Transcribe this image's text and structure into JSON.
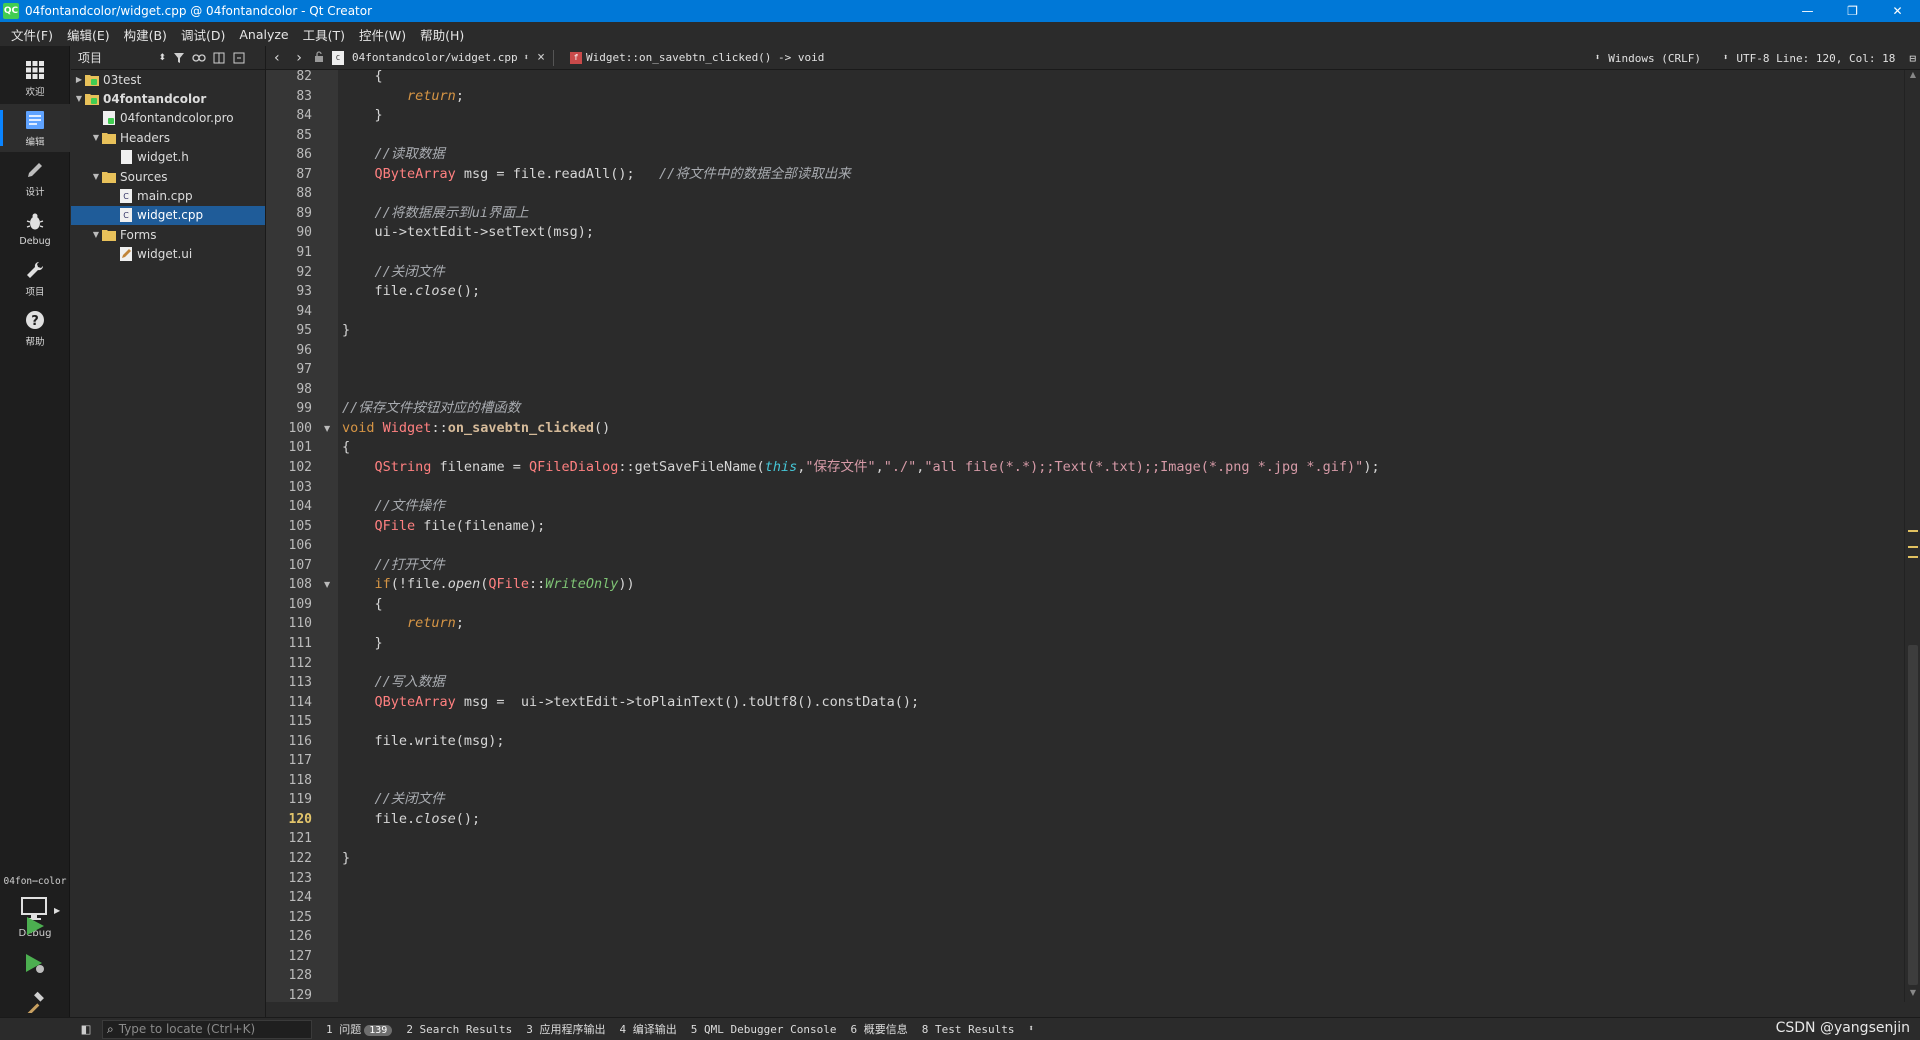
{
  "window": {
    "app_icon": "QC",
    "title": "04fontandcolor/widget.cpp @ 04fontandcolor - Qt Creator",
    "minimize": "—",
    "maximize": "❐",
    "close": "✕"
  },
  "menu": [
    "文件(F)",
    "编辑(E)",
    "构建(B)",
    "调试(D)",
    "Analyze",
    "工具(T)",
    "控件(W)",
    "帮助(H)"
  ],
  "modes": [
    {
      "label": "欢迎",
      "icon": "grid-icon"
    },
    {
      "label": "编辑",
      "icon": "edit-document-icon"
    },
    {
      "label": "设计",
      "icon": "pencil-icon"
    },
    {
      "label": "Debug",
      "icon": "bug-icon"
    },
    {
      "label": "项目",
      "icon": "wrench-icon"
    },
    {
      "label": "帮助",
      "icon": "help-icon"
    }
  ],
  "kit": {
    "project": "04fon⋯color",
    "mode": "Debug"
  },
  "project_pane": {
    "view": "项目",
    "tree": [
      {
        "label": "03test",
        "level": 0,
        "arrow": "▶",
        "icon": "project-folder",
        "bold": false,
        "selected": false
      },
      {
        "label": "04fontandcolor",
        "level": 0,
        "arrow": "▼",
        "icon": "project-folder",
        "bold": true,
        "selected": false
      },
      {
        "label": "04fontandcolor.pro",
        "level": 1,
        "arrow": "",
        "icon": "pro-file",
        "bold": false,
        "selected": false
      },
      {
        "label": "Headers",
        "level": 1,
        "arrow": "▼",
        "icon": "folder",
        "bold": false,
        "selected": false
      },
      {
        "label": "widget.h",
        "level": 2,
        "arrow": "",
        "icon": "header-file",
        "bold": false,
        "selected": false
      },
      {
        "label": "Sources",
        "level": 1,
        "arrow": "▼",
        "icon": "folder",
        "bold": false,
        "selected": false
      },
      {
        "label": "main.cpp",
        "level": 2,
        "arrow": "",
        "icon": "cpp-file",
        "bold": false,
        "selected": false
      },
      {
        "label": "widget.cpp",
        "level": 2,
        "arrow": "",
        "icon": "cpp-file",
        "bold": false,
        "selected": true
      },
      {
        "label": "Forms",
        "level": 1,
        "arrow": "▼",
        "icon": "folder",
        "bold": false,
        "selected": false
      },
      {
        "label": "widget.ui",
        "level": 2,
        "arrow": "",
        "icon": "ui-file",
        "bold": false,
        "selected": false
      }
    ]
  },
  "editor": {
    "document": "04fontandcolor/widget.cpp",
    "symbol": "Widget::on_savebtn_clicked() -> void",
    "line_ending": "Windows (CRLF)",
    "encoding_position": "UTF-8 Line: 120, Col: 18",
    "current_line": 120,
    "lines": [
      {
        "n": 82,
        "code": [
          [
            "    {",
            ""
          ]
        ]
      },
      {
        "n": 83,
        "code": [
          [
            "        ",
            ""
          ],
          [
            "return",
            "k it"
          ],
          [
            ";",
            ""
          ]
        ]
      },
      {
        "n": 84,
        "code": [
          [
            "    }",
            ""
          ]
        ]
      },
      {
        "n": 85,
        "code": []
      },
      {
        "n": 86,
        "code": [
          [
            "    ",
            ""
          ],
          [
            "//读取数据",
            "c"
          ]
        ]
      },
      {
        "n": 87,
        "code": [
          [
            "    ",
            ""
          ],
          [
            "QByteArray",
            "t"
          ],
          [
            " msg = file.readAll();   ",
            ""
          ],
          [
            "//将文件中的数据全部读取出来",
            "c"
          ]
        ]
      },
      {
        "n": 88,
        "code": []
      },
      {
        "n": 89,
        "code": [
          [
            "    ",
            ""
          ],
          [
            "//将数据展示到ui界面上",
            "c"
          ]
        ]
      },
      {
        "n": 90,
        "code": [
          [
            "    ui->textEdit->setText(msg);",
            ""
          ]
        ]
      },
      {
        "n": 91,
        "code": []
      },
      {
        "n": 92,
        "code": [
          [
            "    ",
            ""
          ],
          [
            "//关闭文件",
            "c"
          ]
        ]
      },
      {
        "n": 93,
        "code": [
          [
            "    file.",
            ""
          ],
          [
            "close",
            "it"
          ],
          [
            "();",
            ""
          ]
        ]
      },
      {
        "n": 94,
        "code": []
      },
      {
        "n": 95,
        "code": [
          [
            "}",
            ""
          ]
        ]
      },
      {
        "n": 96,
        "code": []
      },
      {
        "n": 97,
        "code": []
      },
      {
        "n": 98,
        "code": []
      },
      {
        "n": 99,
        "code": [
          [
            "//保存文件按钮对应的槽函数",
            "c"
          ]
        ]
      },
      {
        "n": 100,
        "fold": "▼",
        "code": [
          [
            "void",
            "k"
          ],
          [
            " ",
            ""
          ],
          [
            "Widget",
            "t"
          ],
          [
            "::",
            ""
          ],
          [
            "on_savebtn_clicked",
            "f"
          ],
          [
            "()",
            ""
          ]
        ]
      },
      {
        "n": 101,
        "code": [
          [
            "{",
            ""
          ]
        ]
      },
      {
        "n": 102,
        "code": [
          [
            "    ",
            ""
          ],
          [
            "QString",
            "t"
          ],
          [
            " filename = ",
            ""
          ],
          [
            "QFileDialog",
            "t"
          ],
          [
            "::getSaveFileName(",
            ""
          ],
          [
            "this",
            "i"
          ],
          [
            ",",
            ""
          ],
          [
            "\"保存文件\"",
            "s"
          ],
          [
            ",",
            ""
          ],
          [
            "\"./\"",
            "s"
          ],
          [
            ",",
            ""
          ],
          [
            "\"all file(*.*);;Text(*.txt);;Image(*.png *.jpg *.gif)\"",
            "s"
          ],
          [
            ");",
            ""
          ]
        ]
      },
      {
        "n": 103,
        "code": []
      },
      {
        "n": 104,
        "code": [
          [
            "    ",
            ""
          ],
          [
            "//文件操作",
            "c"
          ]
        ]
      },
      {
        "n": 105,
        "code": [
          [
            "    ",
            ""
          ],
          [
            "QFile",
            "t"
          ],
          [
            " file(filename);",
            ""
          ]
        ]
      },
      {
        "n": 106,
        "code": []
      },
      {
        "n": 107,
        "code": [
          [
            "    ",
            ""
          ],
          [
            "//打开文件",
            "c"
          ]
        ]
      },
      {
        "n": 108,
        "fold": "▼",
        "code": [
          [
            "    ",
            ""
          ],
          [
            "if",
            "k"
          ],
          [
            "(!file.",
            ""
          ],
          [
            "open",
            "it"
          ],
          [
            "(",
            ""
          ],
          [
            "QFile",
            "t"
          ],
          [
            "::",
            ""
          ],
          [
            "WriteOnly",
            "e"
          ],
          [
            "))",
            ""
          ]
        ]
      },
      {
        "n": 109,
        "code": [
          [
            "    {",
            ""
          ]
        ]
      },
      {
        "n": 110,
        "code": [
          [
            "        ",
            ""
          ],
          [
            "return",
            "k it"
          ],
          [
            ";",
            ""
          ]
        ]
      },
      {
        "n": 111,
        "code": [
          [
            "    }",
            ""
          ]
        ]
      },
      {
        "n": 112,
        "code": []
      },
      {
        "n": 113,
        "code": [
          [
            "    ",
            ""
          ],
          [
            "//写入数据",
            "c"
          ]
        ]
      },
      {
        "n": 114,
        "code": [
          [
            "    ",
            ""
          ],
          [
            "QByteArray",
            "t"
          ],
          [
            " msg =  ui->textEdit->toPlainText().toUtf8().constData();",
            ""
          ]
        ]
      },
      {
        "n": 115,
        "code": []
      },
      {
        "n": 116,
        "code": [
          [
            "    file.write(msg);",
            ""
          ]
        ]
      },
      {
        "n": 117,
        "code": []
      },
      {
        "n": 118,
        "code": []
      },
      {
        "n": 119,
        "code": [
          [
            "    ",
            ""
          ],
          [
            "//关闭文件",
            "c"
          ]
        ]
      },
      {
        "n": 120,
        "code": [
          [
            "    file.",
            ""
          ],
          [
            "close",
            "it"
          ],
          [
            "();",
            ""
          ]
        ]
      },
      {
        "n": 121,
        "code": []
      },
      {
        "n": 122,
        "code": [
          [
            "}",
            ""
          ]
        ]
      },
      {
        "n": 123,
        "code": []
      },
      {
        "n": 124,
        "code": []
      },
      {
        "n": 125,
        "code": []
      },
      {
        "n": 126,
        "code": []
      },
      {
        "n": 127,
        "code": []
      },
      {
        "n": 128,
        "code": []
      },
      {
        "n": 129,
        "code": []
      }
    ]
  },
  "statusbar": {
    "locator_placeholder": "Type to locate (Ctrl+K)",
    "panes": [
      {
        "label": "1  问题",
        "badge": "139"
      },
      {
        "label": "2  Search Results"
      },
      {
        "label": "3  应用程序输出"
      },
      {
        "label": "4  编译输出"
      },
      {
        "label": "5  QML Debugger Console"
      },
      {
        "label": "6  概要信息"
      },
      {
        "label": "8  Test Results"
      }
    ],
    "watermark": "CSDN @yangsenjin"
  },
  "colors": {
    "accent": "#0078d7",
    "selection": "#1f5c99",
    "current_line_number": "#e3c56b"
  }
}
